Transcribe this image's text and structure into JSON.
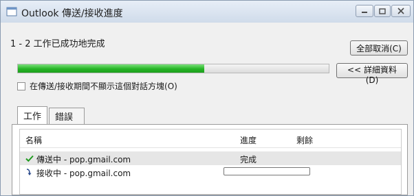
{
  "window": {
    "title": "Outlook 傳送/接收進度",
    "controls": {
      "minimize": "minimize",
      "maximize": "maximize",
      "close": "close"
    },
    "accent_color": "#25b425"
  },
  "summary": {
    "status_text": "1 - 2 工作已成功地完成",
    "overall_progress_percent": 60,
    "cancel_all_label": "全部取消(C)",
    "details_label": "<< 詳細資料(D)",
    "checkbox_label": "在傳送/接收期間不顯示這個對話方塊(O)",
    "checkbox_checked": false
  },
  "tabs": [
    {
      "label": "工作",
      "active": true
    },
    {
      "label": "錯誤",
      "active": false
    }
  ],
  "table": {
    "columns": [
      "名稱",
      "進度",
      "剩餘"
    ],
    "rows": [
      {
        "icon": "checkmark-icon",
        "name": "傳送中 - pop.gmail.com",
        "progress_text": "完成",
        "remaining": ""
      },
      {
        "icon": "arrow-icon",
        "name": "接收中 - pop.gmail.com",
        "progress_percent": 0,
        "remaining": ""
      }
    ]
  }
}
